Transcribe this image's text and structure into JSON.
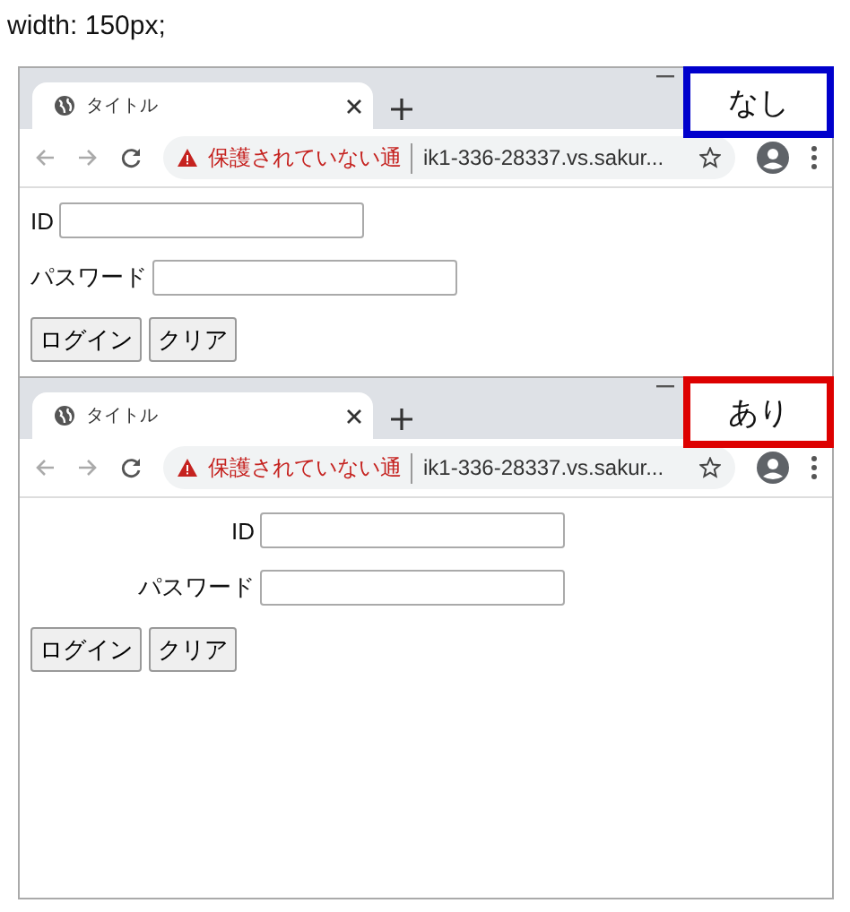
{
  "heading": "width: 150px;",
  "windows": [
    {
      "tab_title": "タイトル",
      "security_warning": "保護されていない通",
      "url": "ik1-336-28337.vs.sakur...",
      "label": {
        "text": "なし",
        "color": "#0000cc"
      },
      "fixed_label_width": false,
      "fields": [
        {
          "label": "ID"
        },
        {
          "label": "パスワード"
        }
      ],
      "buttons": [
        "ログイン",
        "クリア"
      ]
    },
    {
      "tab_title": "タイトル",
      "security_warning": "保護されていない通",
      "url": "ik1-336-28337.vs.sakur...",
      "label": {
        "text": "あり",
        "color": "#dd0000"
      },
      "fixed_label_width": true,
      "fields": [
        {
          "label": "ID"
        },
        {
          "label": "パスワード"
        }
      ],
      "buttons": [
        "ログイン",
        "クリア"
      ]
    }
  ]
}
